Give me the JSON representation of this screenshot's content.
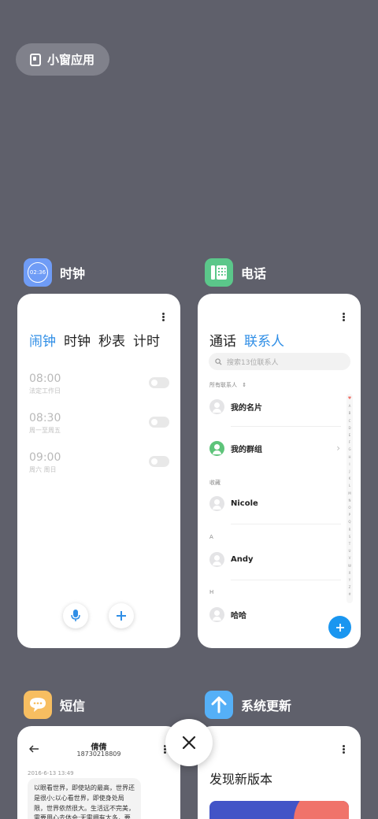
{
  "floating_window": {
    "label": "小窗应用"
  },
  "apps": {
    "clock": {
      "name": "时钟",
      "icon_time": "02:36",
      "tabs": [
        "闹钟",
        "时钟",
        "秒表",
        "计时"
      ],
      "alarms": [
        {
          "time": "08:00",
          "repeat": "法定工作日"
        },
        {
          "time": "08:30",
          "repeat": "周一至周五"
        },
        {
          "time": "09:00",
          "repeat": "周六 周日"
        }
      ]
    },
    "phone": {
      "name": "电话",
      "tabs": [
        "通话",
        "联系人"
      ],
      "search_placeholder": "搜索13位联系人",
      "all_contacts_label": "所有联系人",
      "my_card": "我的名片",
      "my_groups": "我的群组",
      "favorites_label": "收藏",
      "sections": [
        {
          "header": "",
          "name": "Nicole"
        },
        {
          "header": "A",
          "name": "Andy"
        },
        {
          "header": "H",
          "name": "哈哈"
        }
      ],
      "index_letters": [
        "A",
        "B",
        "C",
        "D",
        "E",
        "F",
        "G",
        "H",
        "I",
        "J",
        "K",
        "L",
        "M",
        "N",
        "O",
        "P",
        "Q",
        "R",
        "S",
        "T",
        "U",
        "V",
        "W",
        "X",
        "Y",
        "Z",
        "#"
      ]
    },
    "sms": {
      "name": "短信",
      "contact_name": "倩倩",
      "contact_number": "18730218809",
      "date": "2016-6-13 13:49",
      "message": "以眼看世界，即使站的最高，世界还是很小;以心看世界，即使身处局限，世界依然很大。生活远不完美，需要用心去体会;无需拥有太多，要"
    },
    "update": {
      "name": "系统更新",
      "title": "发现新版本"
    }
  },
  "colors": {
    "background": "#5f606b",
    "accent_blue": "#2f8ee6",
    "clock_icon": "#6f9cf6",
    "phone_icon": "#5bc78a",
    "sms_icon": "#f7be61",
    "update_icon": "#55b0f7"
  }
}
